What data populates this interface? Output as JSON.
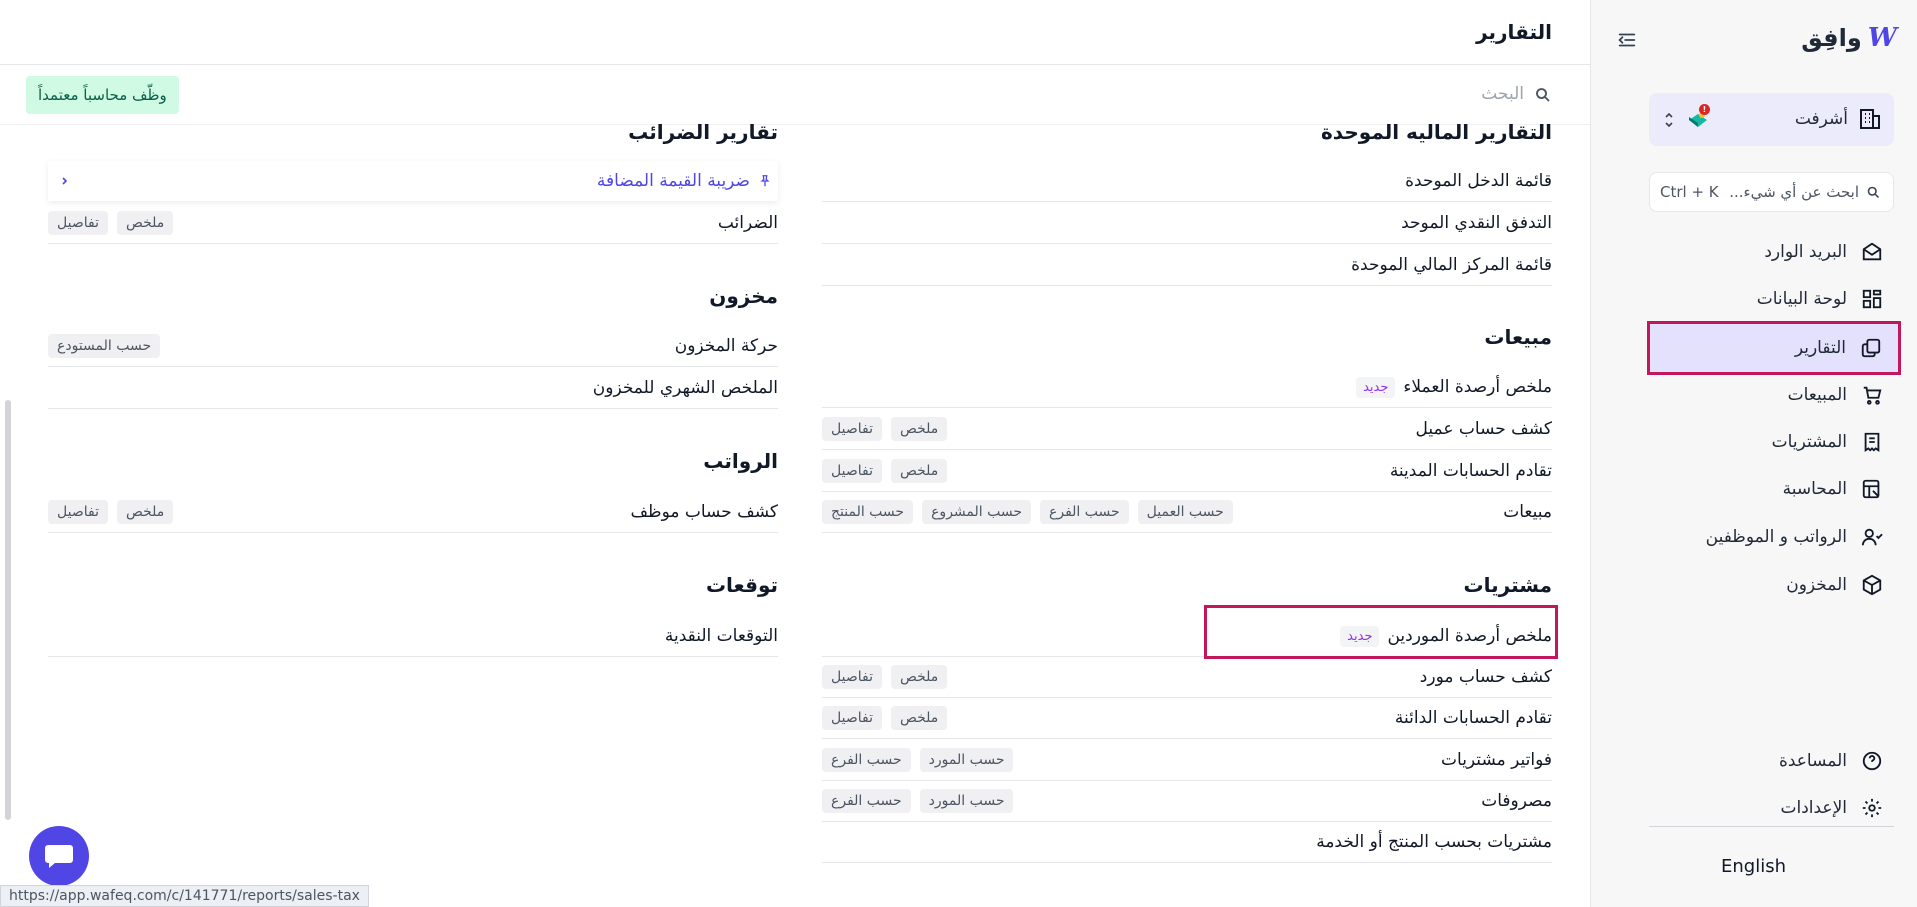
{
  "sidebar": {
    "logo_text": "وافِق",
    "logo_mark": "W",
    "org_name": "أشرفت",
    "org_badge": "!",
    "search_placeholder": "ابحث عن أي شيء...",
    "search_shortcut": "Ctrl + K",
    "items": [
      {
        "label": "البريد الوارد",
        "icon": "inbox-icon"
      },
      {
        "label": "لوحة البيانات",
        "icon": "dashboard-icon"
      },
      {
        "label": "التقارير",
        "icon": "reports-icon",
        "active": true
      },
      {
        "label": "المبيعات",
        "icon": "cart-icon"
      },
      {
        "label": "المشتريات",
        "icon": "receipt-icon"
      },
      {
        "label": "المحاسبة",
        "icon": "accounting-icon"
      },
      {
        "label": "الرواتب و الموظفين",
        "icon": "users-icon"
      },
      {
        "label": "المخزون",
        "icon": "box-icon"
      }
    ],
    "help_label": "المساعدة",
    "settings_label": "الإعدادات",
    "language": "English"
  },
  "header": {
    "title": "التقارير",
    "search_placeholder": "البحث",
    "hire_button": "وظّف محاسباً معتمداً"
  },
  "right_column": {
    "consolidated": {
      "title": "التقارير الماليه الموحدة",
      "rows": [
        "قائمة الدخل الموحدة",
        "التدفق النقدي الموحد",
        "قائمة المركز المالي الموحدة"
      ]
    },
    "sales": {
      "title": "مبيعات",
      "rows": [
        {
          "label": "ملخص أرصدة العملاء",
          "badge": "جديد",
          "tags": []
        },
        {
          "label": "كشف حساب عميل",
          "tags": [
            "ملخص",
            "تفاصيل"
          ]
        },
        {
          "label": "تقادم الحسابات المدينة",
          "tags": [
            "ملخص",
            "تفاصيل"
          ]
        },
        {
          "label": "مبيعات",
          "tags": [
            "حسب العميل",
            "حسب الفرع",
            "حسب المشروع",
            "حسب المنتج"
          ]
        }
      ]
    },
    "purchases": {
      "title": "مشتريات",
      "rows": [
        {
          "label": "ملخص أرصدة الموردين",
          "badge": "جديد",
          "tags": []
        },
        {
          "label": "كشف حساب مورد",
          "tags": [
            "ملخص",
            "تفاصيل"
          ]
        },
        {
          "label": "تقادم الحسابات الدائنة",
          "tags": [
            "ملخص",
            "تفاصيل"
          ]
        },
        {
          "label": "فواتير مشتريات",
          "tags": [
            "حسب المورد",
            "حسب الفرع"
          ]
        },
        {
          "label": "مصروفات",
          "tags": [
            "حسب المورد",
            "حسب الفرع"
          ]
        },
        {
          "label": "مشتريات بحسب المنتج أو الخدمة",
          "tags": []
        }
      ]
    }
  },
  "left_column": {
    "taxes": {
      "title": "تقارير الضرائب",
      "vat_label": "ضريبة القيمة المضافة",
      "rows": [
        {
          "label": "الضرائب",
          "tags": [
            "ملخص",
            "تفاصيل"
          ]
        }
      ]
    },
    "inventory": {
      "title": "مخزون",
      "rows": [
        {
          "label": "حركة المخزون",
          "tags": [
            "حسب المستودع"
          ]
        },
        {
          "label": "الملخص الشهري للمخزون",
          "tags": []
        }
      ]
    },
    "payroll": {
      "title": "الرواتب",
      "rows": [
        {
          "label": "كشف حساب موظف",
          "tags": [
            "ملخص",
            "تفاصيل"
          ]
        }
      ]
    },
    "forecasts": {
      "title": "توقعات",
      "rows": [
        {
          "label": "التوقعات النقدية",
          "tags": []
        }
      ]
    }
  },
  "status_url": "https://app.wafeq.com/c/141771/reports/sales-tax",
  "colors": {
    "accent": "#4f46e5",
    "highlight": "#c2185b",
    "badge_text": "#9333ea"
  }
}
